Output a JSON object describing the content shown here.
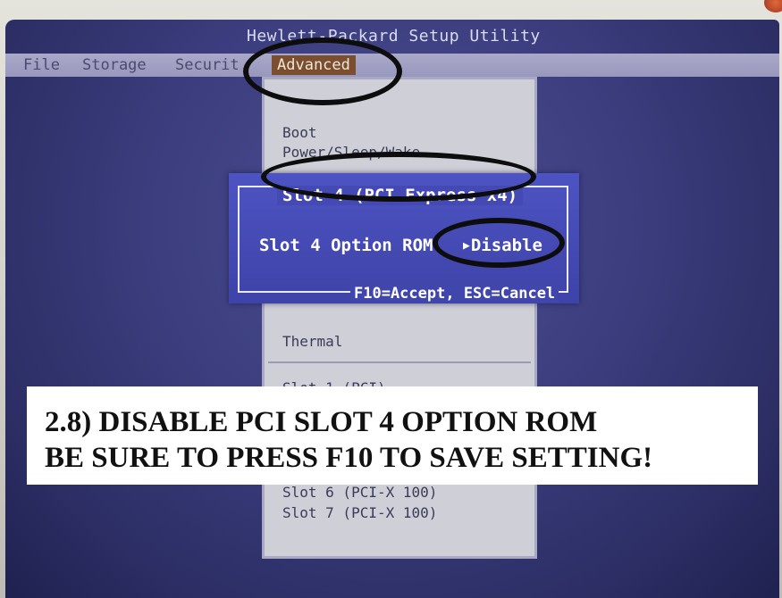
{
  "window": {
    "title": "Hewlett-Packard Setup Utility"
  },
  "menubar": {
    "items": [
      "File",
      "Storage",
      "Securit",
      "Advanced"
    ],
    "active": "Advanced"
  },
  "dropdown": {
    "items_top": [
      "Boot",
      "Power/Sleep/Wake"
    ],
    "item_thermal": "Thermal",
    "items_slots": [
      "Slot 1 (PCI)",
      "Slot 6 (PCI-X 100)",
      "Slot 7 (PCI-X 100)"
    ]
  },
  "dialog": {
    "title": "Slot 4 (PCI Express x4)",
    "option_label": "Slot 4 Option ROM",
    "option_value": "Disable",
    "footer": "F10=Accept, ESC=Cancel"
  },
  "caption": {
    "line1": "2.8) DISABLE PCI SLOT 4 OPTION ROM",
    "line2": "BE SURE TO PRESS F10 TO SAVE SETTING!"
  },
  "icons": {
    "selection_arrow": "right-triangle-icon"
  },
  "colors": {
    "screen_bg": "#3b3d7e",
    "menubar_bg": "#9897bd",
    "active_menu_bg": "#7a4e2e",
    "dialog_bg": "#4549b4",
    "dropdown_bg": "#cfcfd8",
    "annotation": "#0d0d0d"
  }
}
